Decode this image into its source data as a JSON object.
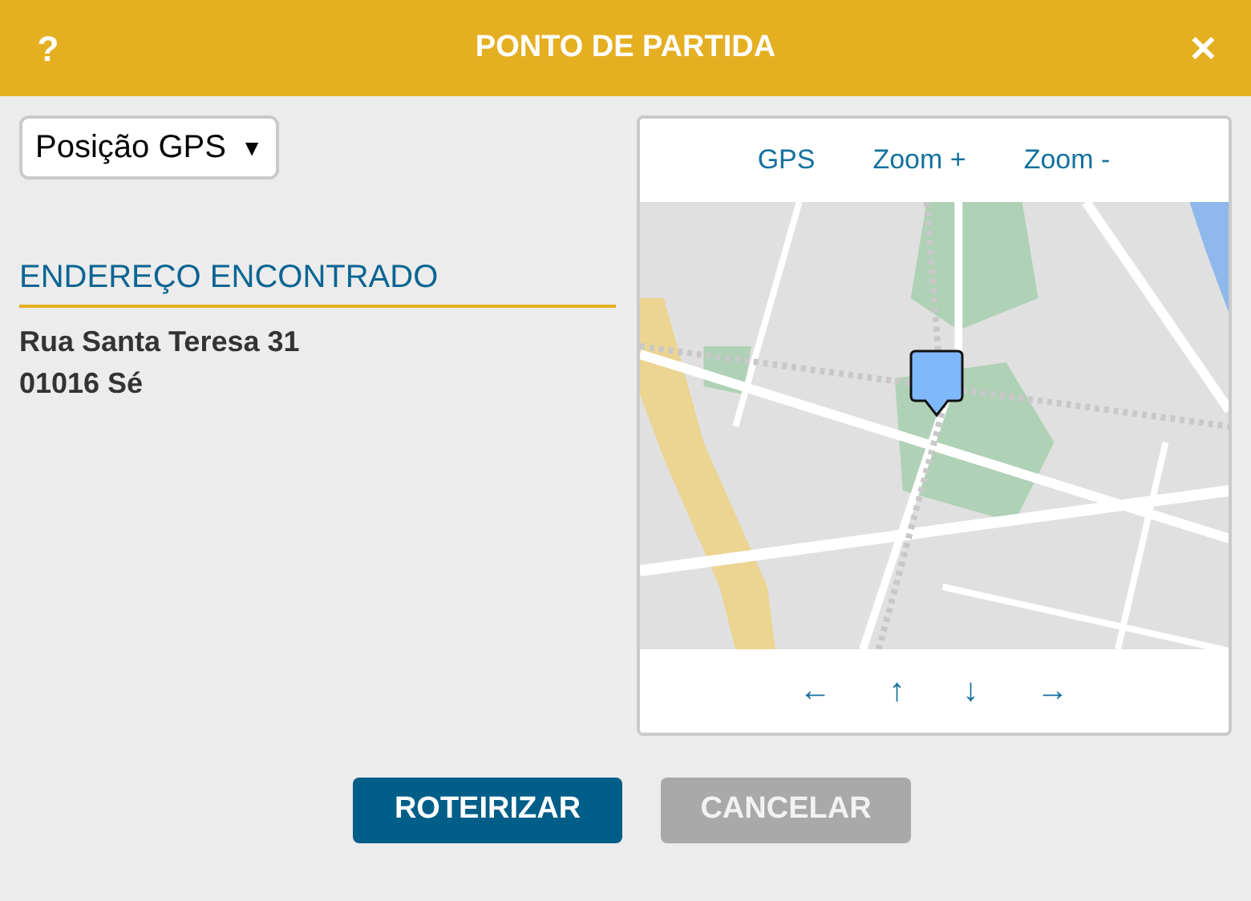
{
  "header": {
    "help": "?",
    "title": "PONTO DE PARTIDA",
    "close": "✕"
  },
  "source_select": {
    "value": "Posição GPS",
    "caret": "▼"
  },
  "address": {
    "heading": "ENDEREÇO ENCONTRADO",
    "lines": [
      "Rua Santa Teresa 31",
      "01016 Sé"
    ]
  },
  "map": {
    "controls": [
      "GPS",
      "Zoom +",
      "Zoom -"
    ],
    "kind": "picture",
    "pan_buttons": [
      "←",
      "↑",
      "↓",
      "→"
    ]
  },
  "buttons": [
    {
      "label": "ROTEIRIZAR",
      "kind": "primary"
    },
    {
      "label": "CANCELAR",
      "kind": "secondary"
    }
  ]
}
